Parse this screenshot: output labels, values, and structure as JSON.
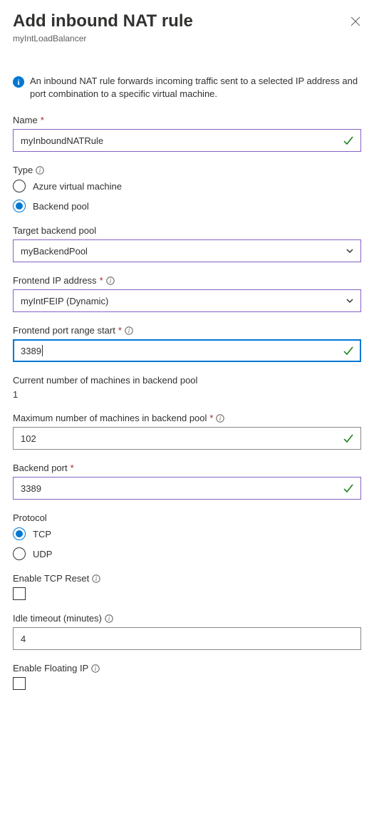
{
  "header": {
    "title": "Add inbound NAT rule",
    "subtitle": "myIntLoadBalancer"
  },
  "info": "An inbound NAT rule forwards incoming traffic sent to a selected IP address and port combination to a specific virtual machine.",
  "name": {
    "label": "Name",
    "value": "myInboundNATRule"
  },
  "type": {
    "label": "Type",
    "options": {
      "vm": "Azure virtual machine",
      "pool": "Backend pool"
    },
    "selected": "pool"
  },
  "target_pool": {
    "label": "Target backend pool",
    "value": "myBackendPool"
  },
  "frontend_ip": {
    "label": "Frontend IP address",
    "value": "myIntFEIP (Dynamic)"
  },
  "frontend_port_start": {
    "label": "Frontend port range start",
    "value": "3389"
  },
  "current_machines": {
    "label": "Current number of machines in backend pool",
    "value": "1"
  },
  "max_machines": {
    "label": "Maximum number of machines in backend pool",
    "value": "102"
  },
  "backend_port": {
    "label": "Backend port",
    "value": "3389"
  },
  "protocol": {
    "label": "Protocol",
    "options": {
      "tcp": "TCP",
      "udp": "UDP"
    },
    "selected": "tcp"
  },
  "tcp_reset": {
    "label": "Enable TCP Reset",
    "checked": false
  },
  "idle_timeout": {
    "label": "Idle timeout (minutes)",
    "value": "4"
  },
  "floating_ip": {
    "label": "Enable Floating IP",
    "checked": false
  }
}
